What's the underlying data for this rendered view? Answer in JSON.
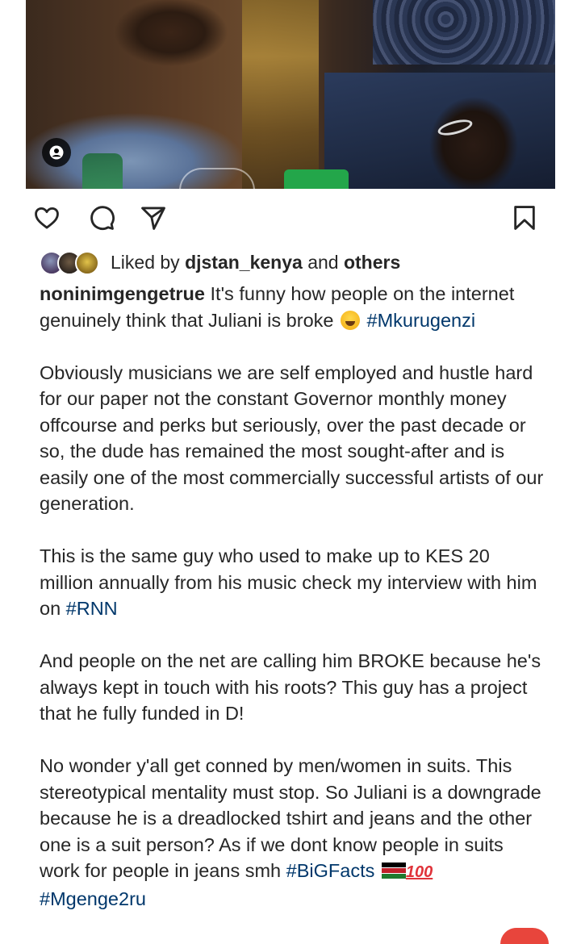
{
  "post": {
    "photo_label": "post photo",
    "tag_icon": "person-tag-icon"
  },
  "actions": {
    "like_icon": "heart-icon",
    "comment_icon": "comment-icon",
    "share_icon": "send-icon",
    "save_icon": "bookmark-icon"
  },
  "likes": {
    "prefix": "Liked by",
    "user": "djstan_kenya",
    "conjunction": "and",
    "others": "others"
  },
  "caption": {
    "username": "noninimgengetrue",
    "intro_text": "It's funny how people on the internet genuinely think that Juliani is broke",
    "intro_hashtag": "#Mkurugenzi",
    "paragraph_1": "Obviously musicians we are self employed and hustle hard for our paper not the constant Governor monthly money offcourse and perks but seriously, over the past decade or so, the dude has remained the most sought-after and is easily one of the most commercially successful artists of our generation.",
    "paragraph_2_text": "This is the same guy who used to make up to KES 20 million annually from his music check my interview with him on",
    "paragraph_2_hashtag": "#RNN",
    "paragraph_3": "And people on the net are calling him BROKE because he's always kept in touch with his roots? This guy has a project that he fully funded in D!",
    "paragraph_4_text": "No wonder y'all get conned by men/women in suits. This stereotypical mentality must stop. So Juliani is a downgrade because he is a dreadlocked tshirt and jeans and the other one is a suit person? As if we dont know people in suits work for people in jeans smh",
    "hashtag_bigfacts": "#BiGFacts",
    "hundred_emoji": "100",
    "hashtag_mgenge": "#Mgenge2ru"
  },
  "colors": {
    "hashtag": "#00376b",
    "text": "#262626"
  }
}
